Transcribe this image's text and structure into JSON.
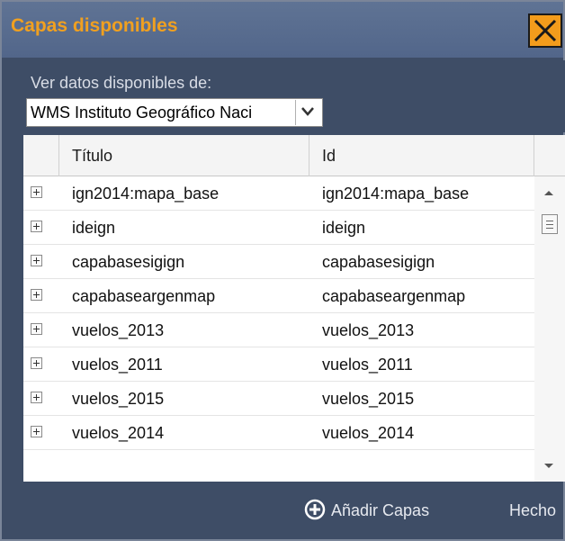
{
  "window": {
    "title": "Capas disponibles"
  },
  "source": {
    "label": "Ver datos disponibles de:",
    "selected": "WMS Instituto Geográfico Naci"
  },
  "table": {
    "columns": [
      "Título",
      "Id"
    ],
    "rows": [
      {
        "title": "ign2014:mapa_base",
        "id": "ign2014:mapa_base"
      },
      {
        "title": "ideign",
        "id": "ideign"
      },
      {
        "title": "capabasesigign",
        "id": "capabasesigign"
      },
      {
        "title": "capabaseargenmap",
        "id": "capabaseargenmap"
      },
      {
        "title": "vuelos_2013",
        "id": "vuelos_2013"
      },
      {
        "title": "vuelos_2011",
        "id": "vuelos_2011"
      },
      {
        "title": "vuelos_2015",
        "id": "vuelos_2015"
      },
      {
        "title": "vuelos_2014",
        "id": "vuelos_2014"
      }
    ]
  },
  "footer": {
    "add_label": "Añadir Capas",
    "done_label": "Hecho"
  },
  "colors": {
    "title": "#f0a020",
    "close_bg": "#f39c1c",
    "panel": "#3e4d66"
  },
  "icons": {
    "close": "close-x-icon",
    "add": "plus-circle-icon",
    "expand": "plus-square-icon"
  }
}
